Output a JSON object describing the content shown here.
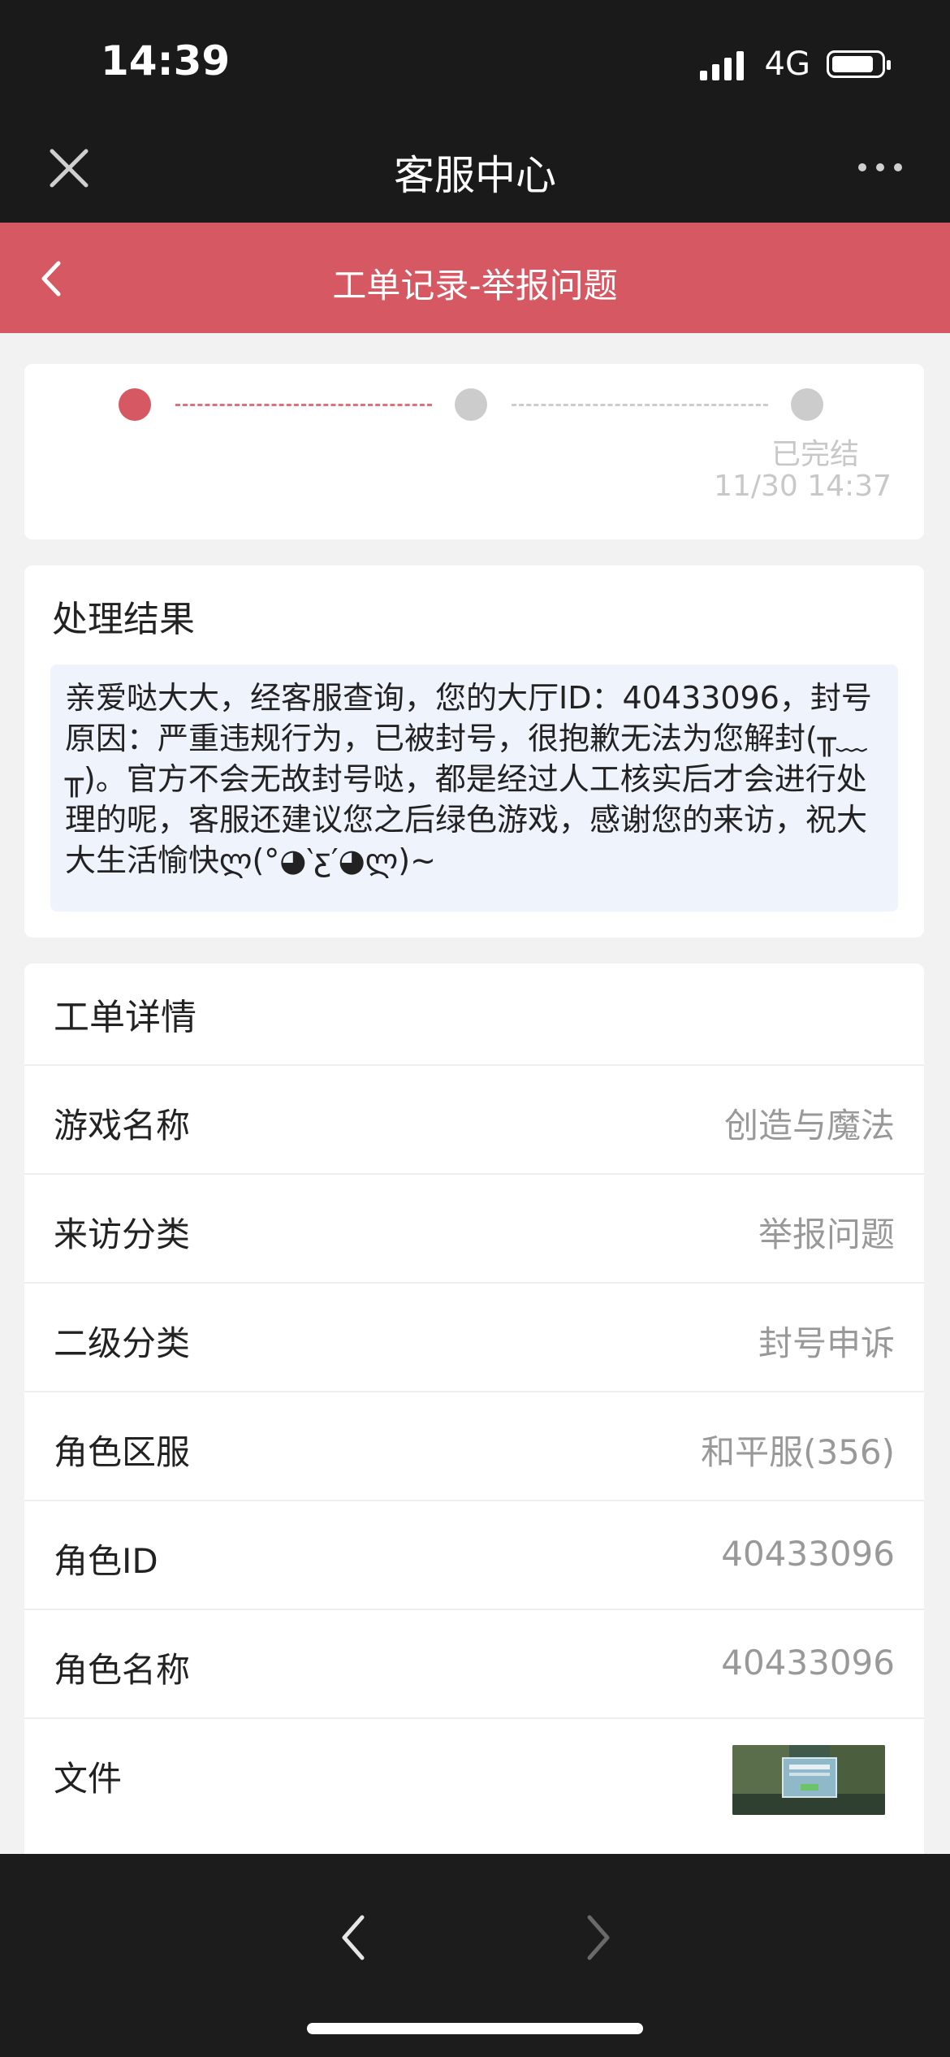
{
  "status_bar": {
    "time": "14:39",
    "network": "4G"
  },
  "nav": {
    "title": "客服中心"
  },
  "header": {
    "title": "工单记录-举报问题"
  },
  "progress": {
    "step_label": "已完结",
    "step_time": "11/30 14:37"
  },
  "result": {
    "title": "处理结果",
    "message": "亲爱哒大大，经客服查询，您的大厅ID：40433096，封号原因：严重违规行为，已被封号，很抱歉无法为您解封(╥﹏╥)。官方不会无故封号哒，都是经过人工核实后才会进行处理的呢，客服还建议您之后绿色游戏，感谢您的来访，祝大大生活愉快ლ(°◕‵ƹ′◕ლ)~"
  },
  "detail": {
    "title": "工单详情",
    "rows": [
      {
        "label": "游戏名称",
        "value": "创造与魔法"
      },
      {
        "label": "来访分类",
        "value": "举报问题"
      },
      {
        "label": "二级分类",
        "value": "封号申诉"
      },
      {
        "label": "角色区服",
        "value": "和平服(356)"
      },
      {
        "label": "角色ID",
        "value": "40433096"
      },
      {
        "label": "角色名称",
        "value": "40433096"
      },
      {
        "label": "文件",
        "value": ""
      }
    ]
  },
  "colors": {
    "accent": "#d65862",
    "dark_bar": "#1a1a1a",
    "info_bg": "#eef3fc"
  }
}
